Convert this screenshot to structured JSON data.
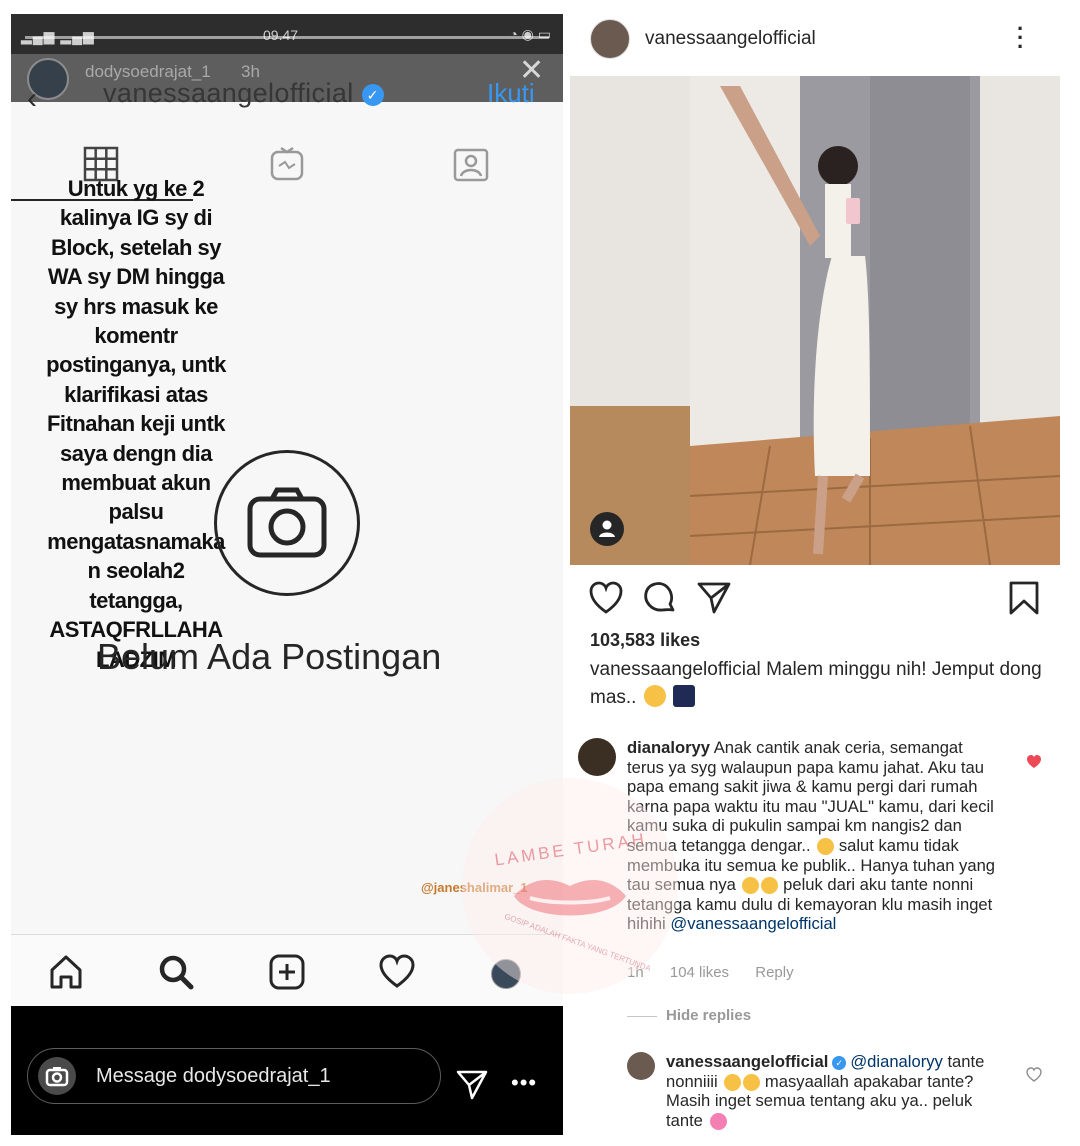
{
  "story": {
    "status_time": "09.47",
    "username": "dodysoedrajat_1",
    "time_ago": "3h",
    "profile_name": "vanessaangelofficial",
    "follow_label": "Ikuti",
    "text_lines": [
      "Untuk yg ke 2",
      "kalinya IG sy di",
      "Block, setelah sy",
      "WA sy DM hingga",
      "sy hrs masuk ke",
      "komentr",
      "postinganya, untk",
      "klarifikasi atas",
      "Fitnahan keji untk",
      "saya dengn dia",
      "membuat akun",
      "palsu",
      "mengatasnamaka",
      "n seolah2",
      "tetangga,",
      "ASTAQFRLLAHA",
      "LADZIM"
    ],
    "empty_title": "Belum Ada Postingan",
    "watermark_tag": "@janeshalimar_1",
    "message_placeholder": "Message dodysoedrajat_1"
  },
  "post": {
    "username": "vanessaangelofficial",
    "likes": "103,583 likes",
    "caption_user": "vanessaangelofficial",
    "caption_text": "Malem minggu nih! Jemput dong mas..",
    "comment": {
      "user": "dianaloryy",
      "text_before_emoji1": "Anak cantik anak ceria, semangat terus ya syg walaupun papa kamu jahat. Aku tau papa emang sakit jiwa & kamu pergi dari rumah karna papa waktu itu mau \"JUAL\" kamu, dari kecil kamu suka di pukulin sampai km nangis2 dan semua tetangga dengar..",
      "text_after_emoji1": "salut kamu tidak membuka itu semua ke publik.. Hanya tuhan yang tau semua nya",
      "text_after_emoji2": "peluk dari aku tante nonni tetangga kamu dulu di kemayoran klu masih inget hihihi",
      "mention": "@vanessaangelofficial",
      "time": "1h",
      "likes": "104 likes",
      "reply_label": "Reply",
      "hide_replies": "Hide replies"
    },
    "reply": {
      "user": "vanessaangelofficial",
      "mention": "@dianaloryy",
      "text_start": "tante nonniiii",
      "text_mid": "masyaallah apakabar tante? Masih inget semua tentang aku ya.. peluk tante"
    }
  },
  "watermark": {
    "brand": "LAMBE TURAH",
    "slogan": "GOSIP ADALAH FAKTA YANG TERTUNDA"
  },
  "colors": {
    "accent_blue": "#3897f0",
    "like_red": "#ed4956",
    "mention_blue": "#003569"
  }
}
